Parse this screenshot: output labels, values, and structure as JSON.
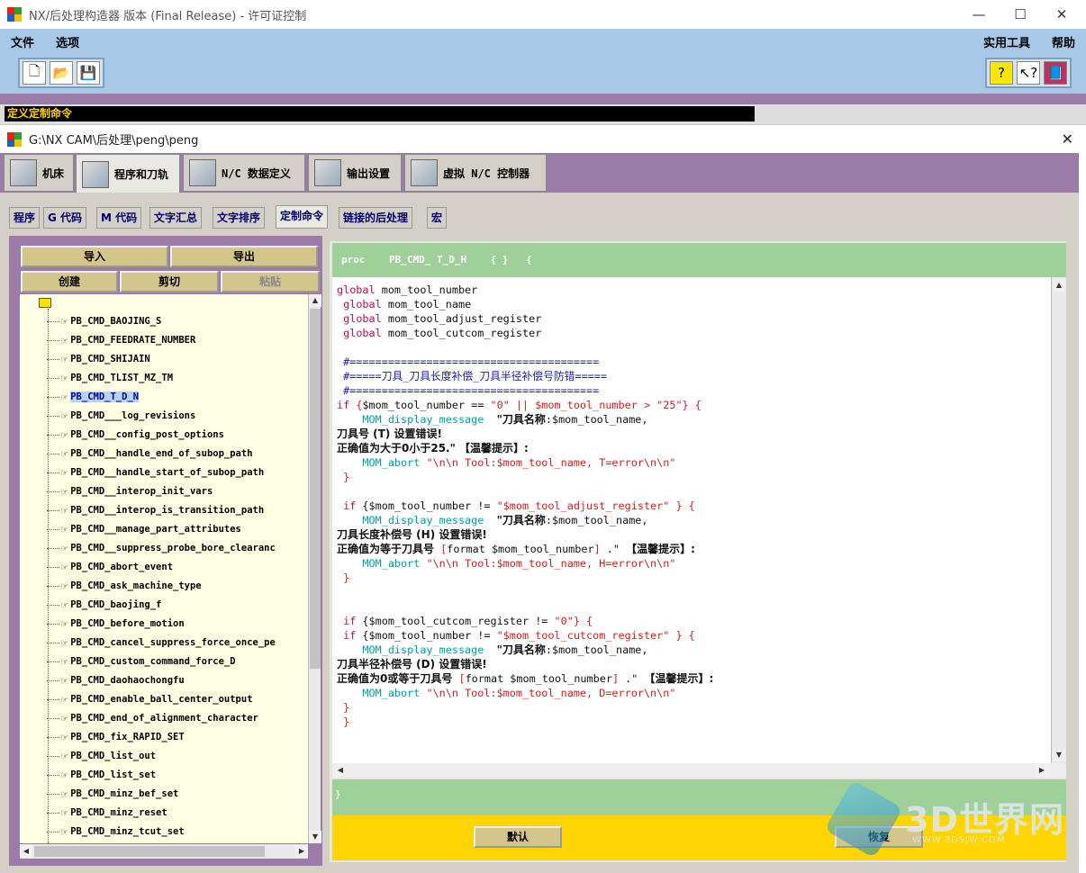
{
  "window": {
    "title": "NX/后处理构造器 版本 (Final Release) - 许可证控制",
    "minimize": "—",
    "maximize": "☐",
    "close": "✕"
  },
  "menu": {
    "file": "文件",
    "options": "选项",
    "utilities": "实用工具",
    "help": "帮助"
  },
  "toolbar": {
    "new_icon": "new-file-icon",
    "open_icon": "open-folder-icon",
    "save_icon": "save-disk-icon"
  },
  "status": {
    "message": "定义定制命令"
  },
  "subwindow": {
    "title": "G:\\NX CAM\\后处理\\peng\\peng",
    "close": "✕"
  },
  "main_tabs": [
    "机床",
    "程序和刀轨",
    "N/C 数据定义",
    "输出设置",
    "虚拟 N/C 控制器"
  ],
  "sub_tabs": [
    "程序",
    "G 代码",
    "M 代码",
    "文字汇总",
    "文字排序",
    "定制命令",
    "链接的后处理",
    "宏"
  ],
  "buttons": {
    "import": "导入",
    "export": "导出",
    "create": "创建",
    "cut": "剪切",
    "paste": "粘贴",
    "default": "默认",
    "restore": "恢复"
  },
  "tree_items": [
    "PB_CMD_BAOJING_S",
    "PB_CMD_FEEDRATE_NUMBER",
    "PB_CMD_SHIJAIN",
    "PB_CMD_TLIST_MZ_TM",
    "PB_CMD_T_D_N",
    "PB_CMD___log_revisions",
    "PB_CMD__config_post_options",
    "PB_CMD__handle_end_of_subop_path",
    "PB_CMD__handle_start_of_subop_path",
    "PB_CMD__interop_init_vars",
    "PB_CMD__interop_is_transition_path",
    "PB_CMD__manage_part_attributes",
    "PB_CMD__suppress_probe_bore_clearanc",
    "PB_CMD_abort_event",
    "PB_CMD_ask_machine_type",
    "PB_CMD_baojing_f",
    "PB_CMD_before_motion",
    "PB_CMD_cancel_suppress_force_once_pe",
    "PB_CMD_custom_command_force_D",
    "PB_CMD_daohaochongfu",
    "PB_CMD_enable_ball_center_output",
    "PB_CMD_end_of_alignment_character",
    "PB_CMD_fix_RAPID_SET",
    "PB_CMD_list_out",
    "PB_CMD_list_set",
    "PB_CMD_minz_bef_set",
    "PB_CMD_minz_reset",
    "PB_CMD_minz_tcut_set"
  ],
  "selected_item": "PB_CMD_T_D_N",
  "proc_header": "proc    PB_CMD_ T_D_H    { }   {",
  "closing_brace": "}",
  "watermark": {
    "text": "3D世界网",
    "url": "WWW.3DSJW.COM"
  }
}
